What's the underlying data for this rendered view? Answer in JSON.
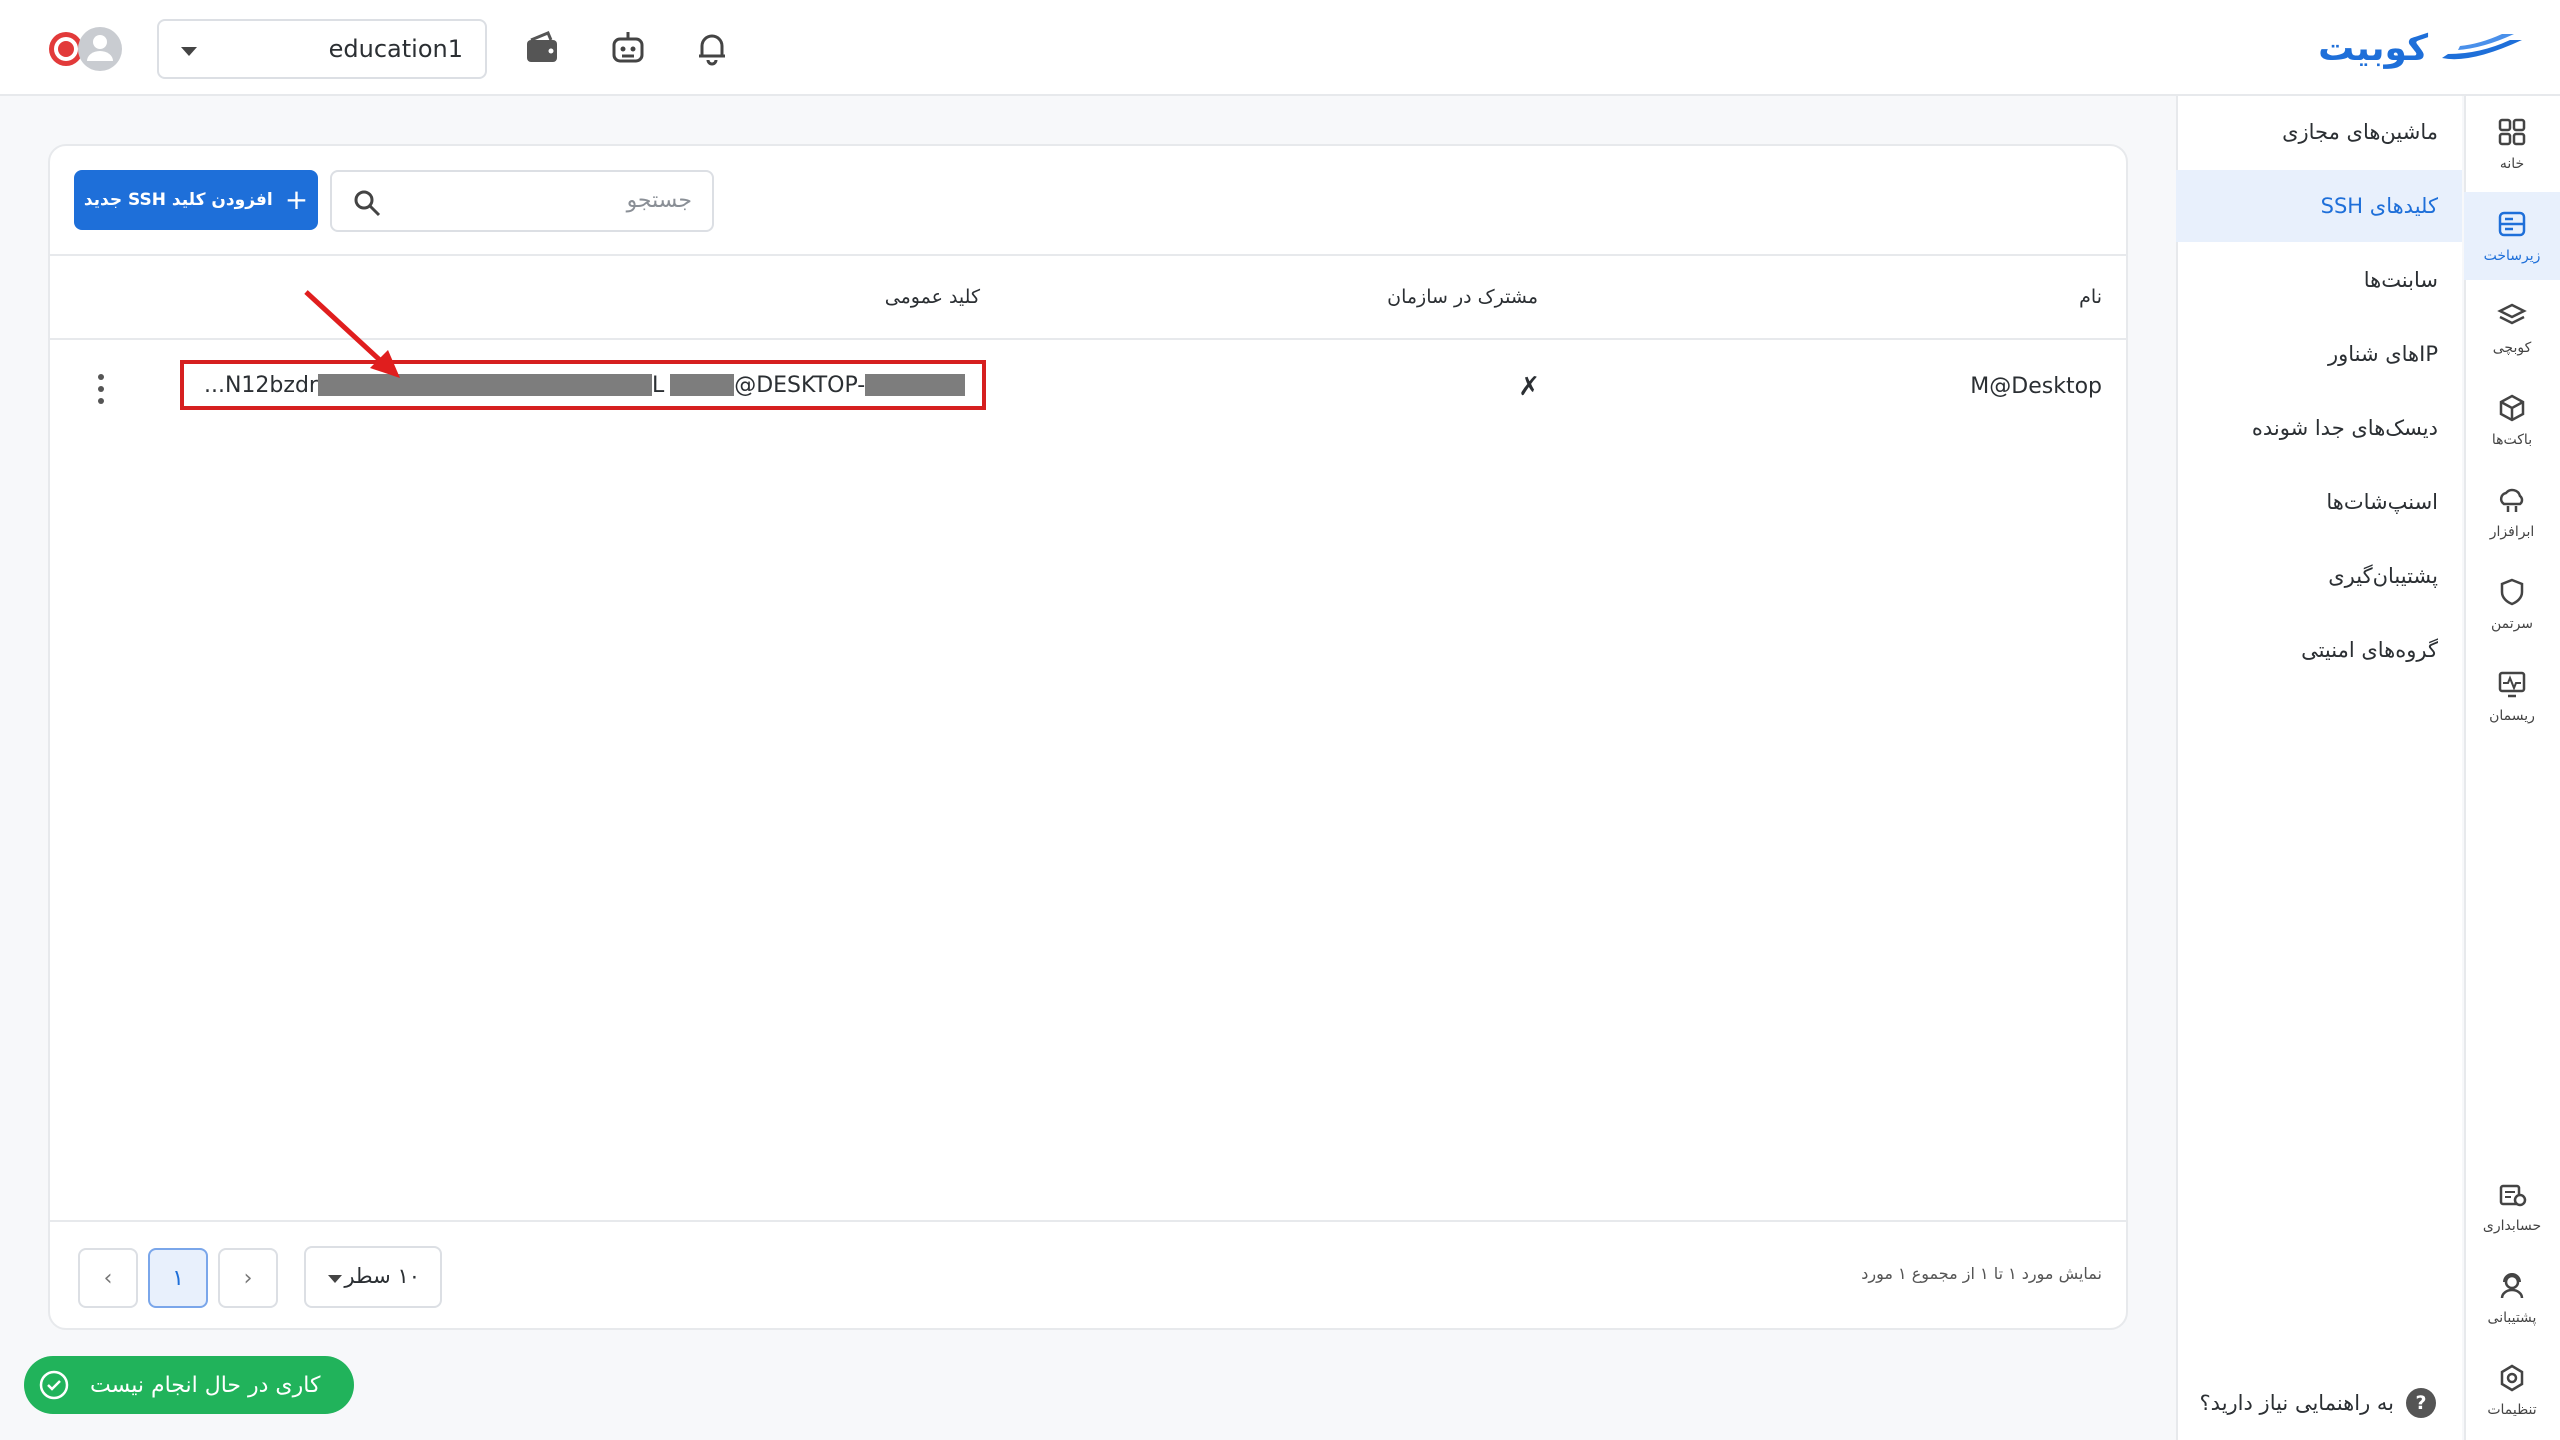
{
  "brand": {
    "logo_text": "کوبیت",
    "accent": "#1e6fd9"
  },
  "header": {
    "project": "education1",
    "icons": [
      "wallet-icon",
      "robot-icon",
      "bell-icon"
    ]
  },
  "rail": {
    "items": [
      {
        "key": "home",
        "label": "خانه",
        "icon": "grid-icon"
      },
      {
        "key": "infra",
        "label": "زیرساخت",
        "icon": "server-icon",
        "active": true
      },
      {
        "key": "kubernetes",
        "label": "کوبچی",
        "icon": "layers-icon"
      },
      {
        "key": "buckets",
        "label": "باکت‌ها",
        "icon": "cube-icon"
      },
      {
        "key": "cloud",
        "label": "ابرافزار",
        "icon": "cloud-icon"
      },
      {
        "key": "security",
        "label": "سرتمن",
        "icon": "shield-icon"
      },
      {
        "key": "monitoring",
        "label": "ریسمان",
        "icon": "monitor-icon"
      }
    ],
    "bottom_items": [
      {
        "key": "accounting",
        "label": "حسابداری",
        "icon": "accounting-icon"
      },
      {
        "key": "support",
        "label": "پشتیبانی",
        "icon": "support-icon"
      },
      {
        "key": "settings",
        "label": "تنظیمات",
        "icon": "settings-icon"
      }
    ]
  },
  "submenu": {
    "items": [
      {
        "label": "ماشین‌های مجازی"
      },
      {
        "label": "کلیدهای SSH",
        "active": true
      },
      {
        "label": "سابنت‌ها"
      },
      {
        "label": "IPهای شناور"
      },
      {
        "label": "دیسک‌های جدا شونده"
      },
      {
        "label": "اسنپ‌شات‌ها"
      },
      {
        "label": "پشتیبان‌گیری"
      },
      {
        "label": "گروه‌های امنیتی"
      }
    ],
    "help": "به راهنمایی نیاز دارید؟"
  },
  "toolbar": {
    "add_label": "افزودن کلید SSH جدید",
    "search_placeholder": "جستجو"
  },
  "table": {
    "headers": {
      "name": "نام",
      "shared": "مشترک در سازمان",
      "public_key": "کلید عمومی"
    },
    "rows": [
      {
        "name": "M@Desktop",
        "shared": "✗",
        "key_prefix": "...N12bzdr",
        "key_mid": "L",
        "key_host": "@DESKTOP-"
      }
    ]
  },
  "pagination": {
    "summary": "نمایش مورد ۱ تا ۱ از مجموع ۱ مورد",
    "rows_per_page": "۱۰ سطر",
    "current_page": "۱",
    "prev": "‹",
    "next": "›"
  },
  "status": {
    "text": "کاری در حال انجام نیست",
    "color": "#21b35b"
  }
}
